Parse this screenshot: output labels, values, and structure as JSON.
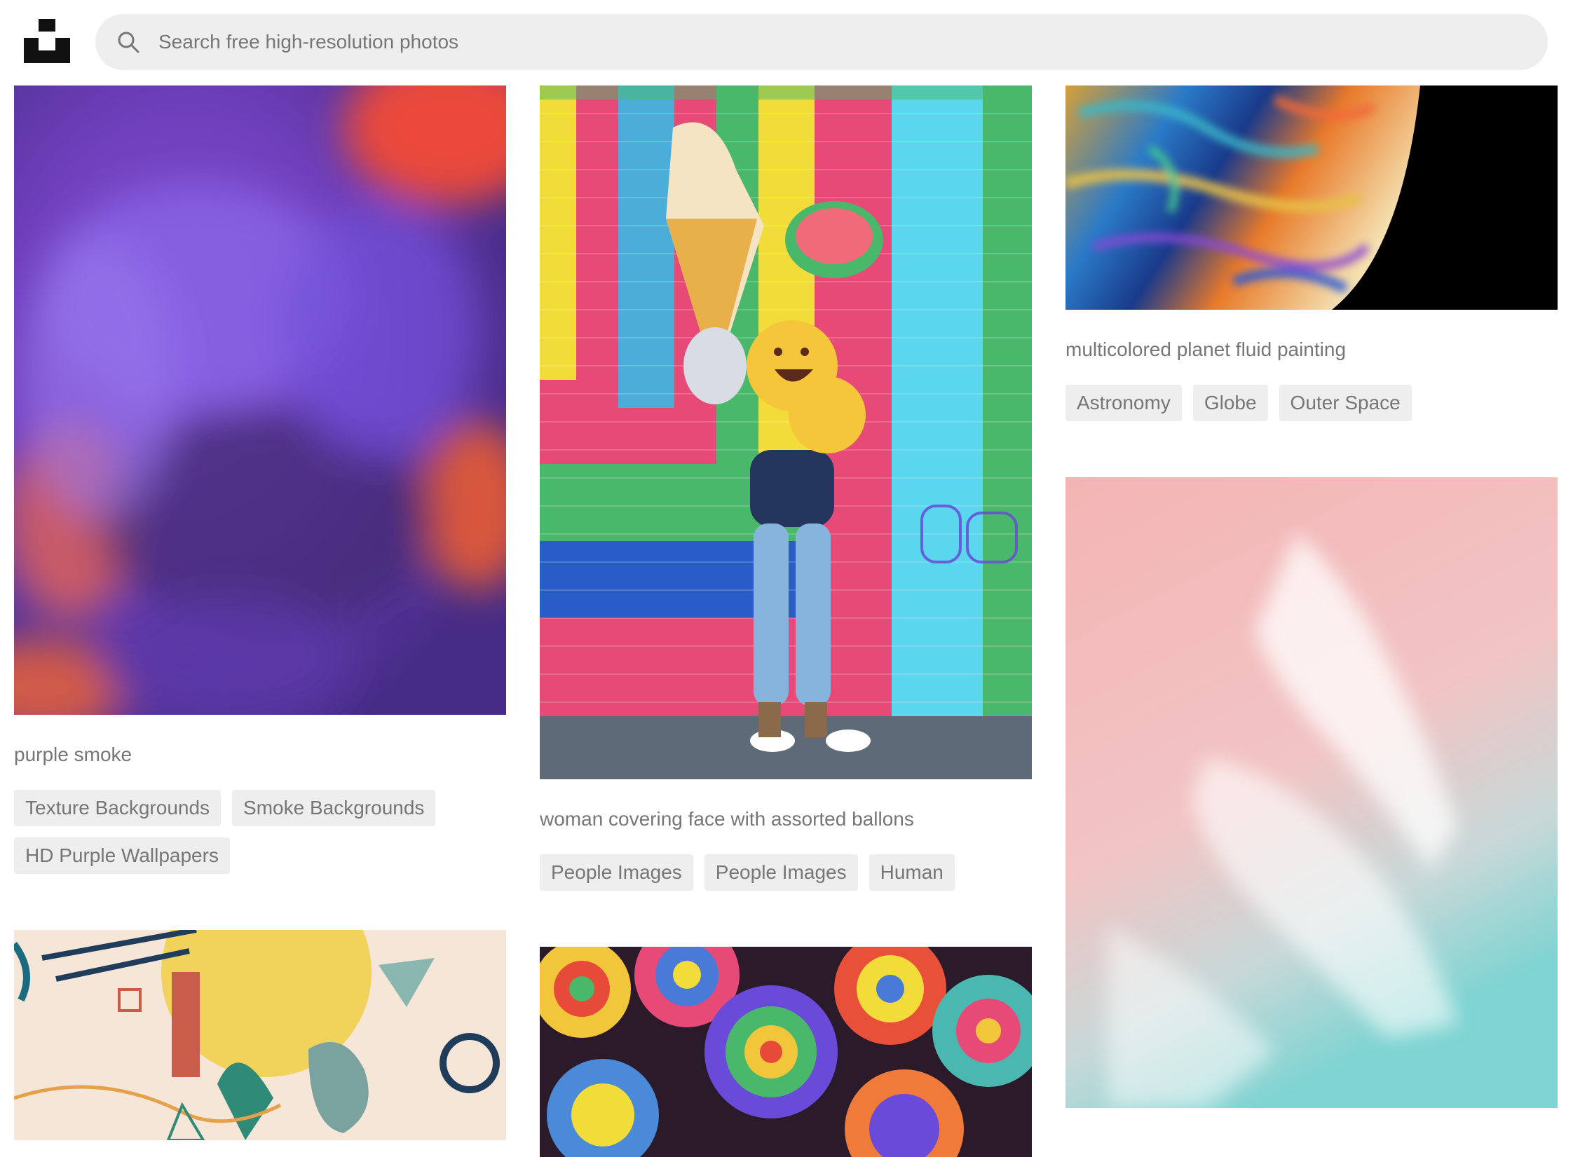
{
  "search": {
    "placeholder": "Search free high-resolution photos"
  },
  "photos": [
    {
      "caption": "purple smoke",
      "tags": [
        "Texture Backgrounds",
        "Smoke Backgrounds",
        "HD Purple Wallpapers"
      ]
    },
    {
      "caption": "woman covering face with assorted ballons",
      "tags": [
        "People Images",
        "People Images",
        "Human"
      ]
    },
    {
      "caption": "multicolored planet fluid painting",
      "tags": [
        "Astronomy",
        "Globe",
        "Outer Space"
      ]
    }
  ],
  "colors": {
    "tag_bg": "#eeeeee",
    "muted_text": "#767676",
    "search_bg": "#eeeeee",
    "logo": "#111111"
  }
}
